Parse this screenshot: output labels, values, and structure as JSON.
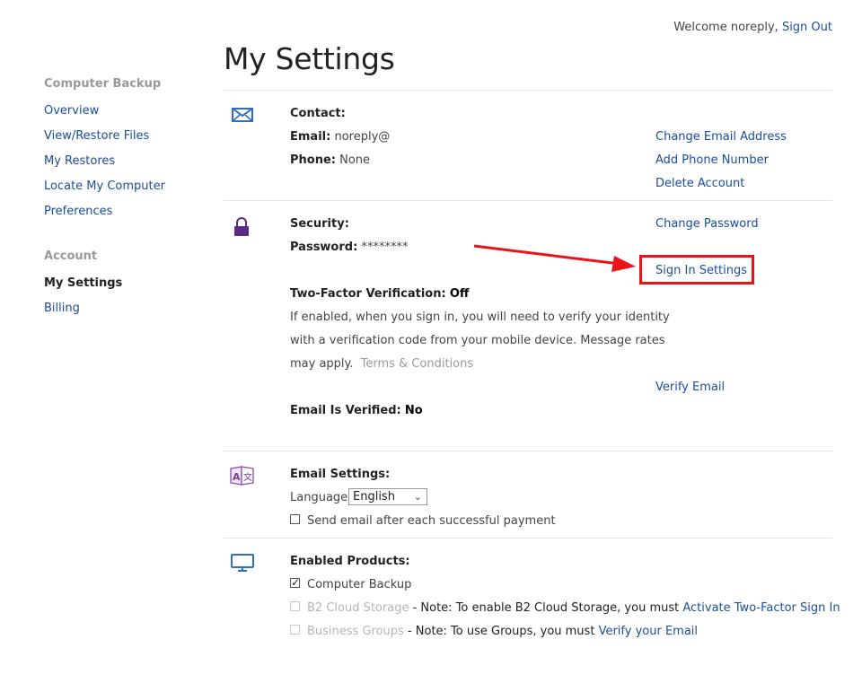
{
  "header": {
    "welcome_text": "Welcome noreply,",
    "sign_out_label": "Sign Out",
    "page_title": "My Settings"
  },
  "sidebar": {
    "sections": [
      {
        "heading": "Computer Backup",
        "items": [
          {
            "label": "Overview"
          },
          {
            "label": "View/Restore Files"
          },
          {
            "label": "My Restores"
          },
          {
            "label": "Locate My Computer"
          },
          {
            "label": "Preferences"
          }
        ]
      },
      {
        "heading": "Account",
        "items": [
          {
            "label": "My Settings",
            "active": true
          },
          {
            "label": "Billing"
          }
        ]
      }
    ]
  },
  "contact": {
    "heading": "Contact:",
    "email_label": "Email:",
    "email_value": "noreply@",
    "phone_label": "Phone:",
    "phone_value": "None",
    "links": [
      "Change Email Address",
      "Add Phone Number",
      "Delete Account"
    ],
    "icon": "envelope-icon"
  },
  "security": {
    "heading": "Security:",
    "password_label": "Password:",
    "password_value": "********",
    "change_password_label": "Change Password",
    "sign_in_settings_label": "Sign In Settings",
    "two_factor_label": "Two-Factor Verification:",
    "two_factor_value": "Off",
    "description_lines": [
      "If enabled, when you sign in, you will need to verify your identity",
      "with a verification code from your mobile device. Message rates",
      "may apply."
    ],
    "terms_label": "Terms & Conditions",
    "verify_email_label": "Verify Email",
    "email_verified_label": "Email Is Verified:",
    "email_verified_value": "No",
    "icon": "lock-icon",
    "highlight_color": "#e8141a"
  },
  "email_settings": {
    "heading": "Email Settings:",
    "language_label": "Language:",
    "language_selected": "English",
    "send_email_label": "Send email after each successful payment",
    "send_email_checked": false,
    "icon": "language-icon"
  },
  "products": {
    "heading": "Enabled Products:",
    "computer_backup_label": "Computer Backup",
    "computer_backup_checked": true,
    "b2_label": "B2 Cloud Storage",
    "b2_note": " - Note: To enable B2 Cloud Storage, you must ",
    "b2_link": "Activate Two-Factor Sign In",
    "groups_label": "Business Groups",
    "groups_note": " - Note: To use Groups, you must ",
    "groups_link": "Verify your Email",
    "icon": "monitor-icon"
  },
  "colors": {
    "link": "#1a4d9c",
    "accent_purple": "#5b2a86",
    "icon_blue": "#2f6fc0"
  }
}
